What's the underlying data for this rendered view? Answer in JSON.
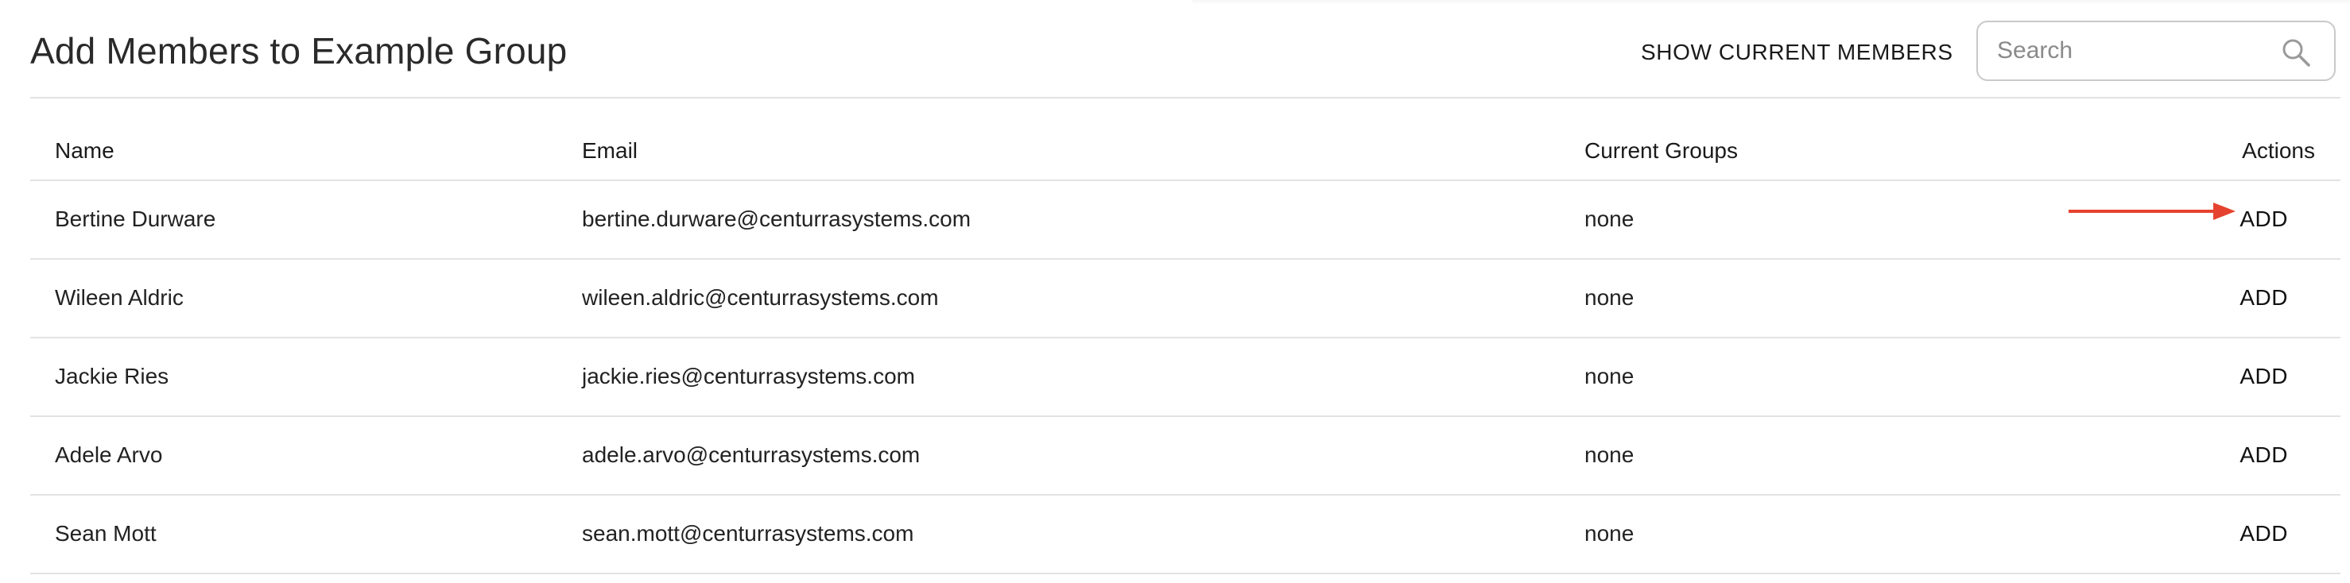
{
  "header": {
    "title": "Add Members to Example Group",
    "show_members_label": "SHOW CURRENT MEMBERS",
    "search": {
      "placeholder": "Search",
      "value": "",
      "icon": "search-icon"
    }
  },
  "table": {
    "columns": {
      "name": "Name",
      "email": "Email",
      "groups": "Current Groups",
      "actions": "Actions"
    },
    "rows": [
      {
        "name": "Bertine Durware",
        "email": "bertine.durware@centurrasystems.com",
        "groups": "none",
        "action": "ADD"
      },
      {
        "name": "Wileen Aldric",
        "email": "wileen.aldric@centurrasystems.com",
        "groups": "none",
        "action": "ADD"
      },
      {
        "name": "Jackie Ries",
        "email": "jackie.ries@centurrasystems.com",
        "groups": "none",
        "action": "ADD"
      },
      {
        "name": "Adele Arvo",
        "email": "adele.arvo@centurrasystems.com",
        "groups": "none",
        "action": "ADD"
      },
      {
        "name": "Sean Mott",
        "email": "sean.mott@centurrasystems.com",
        "groups": "none",
        "action": "ADD"
      }
    ]
  },
  "annotation": {
    "arrow_color": "#e5432f",
    "arrow_icon": "arrow-right-icon"
  }
}
